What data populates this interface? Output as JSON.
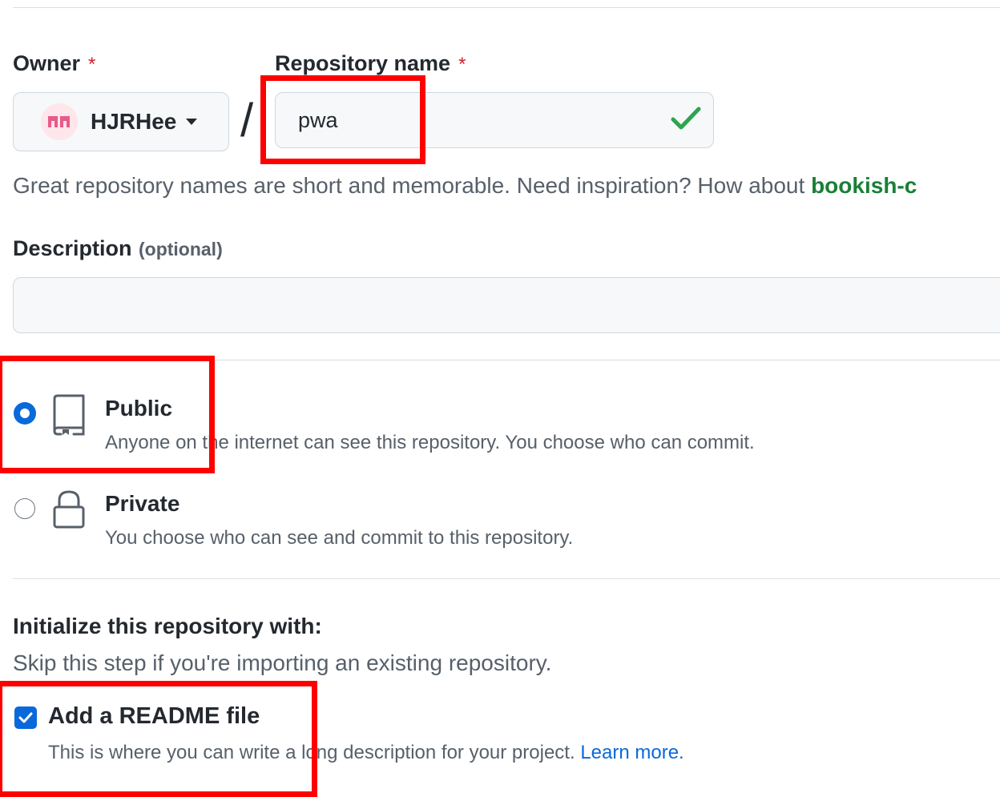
{
  "owner": {
    "label": "Owner",
    "required_mark": "*",
    "name": "HJRHee"
  },
  "separator": "/",
  "repository": {
    "label": "Repository name",
    "required_mark": "*",
    "value": "pwa"
  },
  "help": {
    "text": "Great repository names are short and memorable. Need inspiration? How about ",
    "suggestion": "bookish-c"
  },
  "description": {
    "label": "Description",
    "optional": "(optional)",
    "value": ""
  },
  "visibility": {
    "public": {
      "title": "Public",
      "desc": "Anyone on the internet can see this repository. You choose who can commit.",
      "selected": true
    },
    "private": {
      "title": "Private",
      "desc": "You choose who can see and commit to this repository.",
      "selected": false
    }
  },
  "init": {
    "title": "Initialize this repository with:",
    "subtitle": "Skip this step if you're importing an existing repository.",
    "readme": {
      "label": "Add a README file",
      "desc": "This is where you can write a long description for your project. ",
      "link": "Learn more.",
      "checked": true
    }
  },
  "colors": {
    "accent": "#0969da",
    "success": "#2da44e",
    "required": "#cf222e",
    "annotation": "#ff0000"
  },
  "icons": [
    "avatar-icon",
    "caret-down-icon",
    "checkmark-icon",
    "repo-icon",
    "lock-icon",
    "checkbox-check-icon"
  ]
}
